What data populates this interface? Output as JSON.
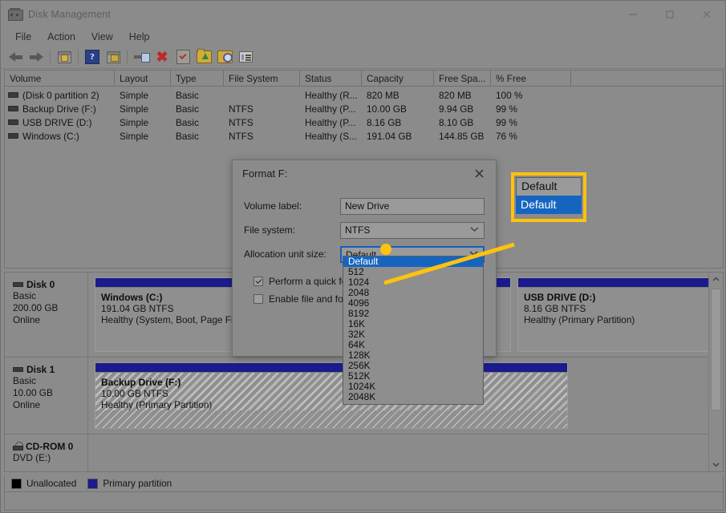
{
  "window": {
    "title": "Disk Management",
    "icon": "disk-management-icon",
    "minimize": "─",
    "maximize": "□",
    "close": "✕"
  },
  "menu": {
    "items": [
      "File",
      "Action",
      "View",
      "Help"
    ]
  },
  "toolbar": {
    "items": [
      {
        "name": "back-icon",
        "label": "Back"
      },
      {
        "name": "forward-icon",
        "label": "Forward"
      },
      {
        "name": "show-hide-console-tree-icon",
        "label": "Show/Hide Console Tree"
      },
      {
        "name": "help-icon",
        "label": "Help"
      },
      {
        "name": "properties-icon",
        "label": "Properties"
      },
      {
        "name": "rescan-disks-icon",
        "label": "Rescan Disks"
      },
      {
        "name": "delete-icon",
        "label": "Delete"
      },
      {
        "name": "check-icon",
        "label": "Check"
      },
      {
        "name": "folder-up-icon",
        "label": "Up One Level"
      },
      {
        "name": "search-folder-icon",
        "label": "Search"
      },
      {
        "name": "list-view-icon",
        "label": "List View"
      }
    ]
  },
  "volume_list": {
    "columns": [
      "Volume",
      "Layout",
      "Type",
      "File System",
      "Status",
      "Capacity",
      "Free Spa...",
      "% Free"
    ],
    "rows": [
      {
        "volume": "(Disk 0 partition 2)",
        "layout": "Simple",
        "type": "Basic",
        "file_system": "",
        "status": "Healthy (R...",
        "capacity": "820 MB",
        "free_space": "820 MB",
        "percent_free": "100 %"
      },
      {
        "volume": "Backup Drive (F:)",
        "layout": "Simple",
        "type": "Basic",
        "file_system": "NTFS",
        "status": "Healthy (P...",
        "capacity": "10.00 GB",
        "free_space": "9.94 GB",
        "percent_free": "99 %"
      },
      {
        "volume": "USB DRIVE (D:)",
        "layout": "Simple",
        "type": "Basic",
        "file_system": "NTFS",
        "status": "Healthy (P...",
        "capacity": "8.16 GB",
        "free_space": "8.10 GB",
        "percent_free": "99 %"
      },
      {
        "volume": "Windows (C:)",
        "layout": "Simple",
        "type": "Basic",
        "file_system": "NTFS",
        "status": "Healthy (S...",
        "capacity": "191.04 GB",
        "free_space": "144.85 GB",
        "percent_free": "76 %"
      }
    ]
  },
  "disks": [
    {
      "name": "Disk 0",
      "type": "Basic",
      "size": "200.00 GB",
      "state": "Online",
      "partitions": [
        {
          "title": "Windows  (C:)",
          "size": "191.04 GB NTFS",
          "status": "Healthy (System, Boot, Page File,"
        }
      ]
    },
    {
      "name": "Disk 1",
      "type": "Basic",
      "size": "10.00 GB",
      "state": "Online",
      "partitions": [
        {
          "title": "Backup Drive  (F:)",
          "size": "10.00 GB NTFS",
          "status": "Healthy (Primary Partition)"
        }
      ]
    },
    {
      "name": "CD-ROM 0",
      "type": "DVD (E:)",
      "size": "",
      "state": "",
      "partitions": []
    }
  ],
  "usb_disk": {
    "title": "USB DRIVE  (D:)",
    "size": "8.16 GB NTFS",
    "status": "Healthy (Primary Partition)"
  },
  "legend": {
    "items": [
      {
        "label": "Unallocated",
        "color": "#000000"
      },
      {
        "label": "Primary partition",
        "color": "#1b1b8c"
      }
    ]
  },
  "dialog": {
    "title": "Format F:",
    "close": "✕",
    "fields": [
      {
        "label": "Volume label:",
        "value": "New Drive",
        "control": "text"
      },
      {
        "label": "File system:",
        "value": "NTFS",
        "control": "combo"
      },
      {
        "label": "Allocation unit size:",
        "value": "Default",
        "control": "combo"
      }
    ],
    "checkboxes": [
      {
        "label": "Perform a quick format",
        "checked": true
      },
      {
        "label": "Enable file and folder c",
        "checked": false
      }
    ]
  },
  "dropdown": {
    "selected": "Default",
    "options": [
      "Default",
      "512",
      "1024",
      "2048",
      "4096",
      "8192",
      "16K",
      "32K",
      "64K",
      "128K",
      "256K",
      "512K",
      "1024K",
      "2048K"
    ]
  },
  "callout": {
    "line1": "Default",
    "line2": "Default",
    "border_color": "#ffc20e"
  },
  "colors": {
    "window_bg": "#8b8b8b",
    "primary_partition": "#1b1b8c",
    "selection_blue": "#1565c0",
    "highlight_yellow": "#ffc20e"
  },
  "scrollbar": {
    "up_arrow": "ⱏ",
    "down_arrow": "ⱟ"
  }
}
